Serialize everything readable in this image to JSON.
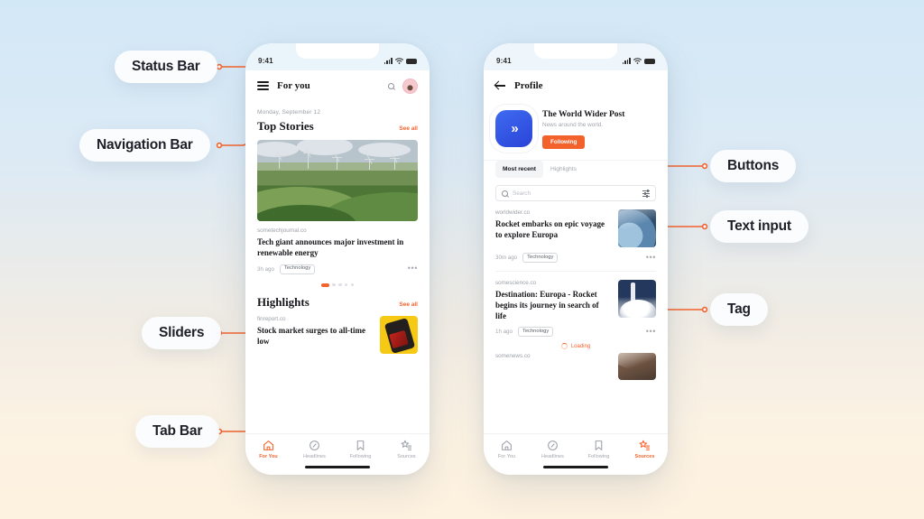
{
  "annotations": [
    {
      "id": "status-bar",
      "label": "Status Bar"
    },
    {
      "id": "navigation-bar",
      "label": "Navigation Bar"
    },
    {
      "id": "sliders",
      "label": "Sliders"
    },
    {
      "id": "tab-bar",
      "label": "Tab Bar"
    },
    {
      "id": "buttons",
      "label": "Buttons"
    },
    {
      "id": "text-input",
      "label": "Text input"
    },
    {
      "id": "tag",
      "label": "Tag"
    }
  ],
  "colors": {
    "accent": "#f4622c",
    "brand_blue": "#2a43d8",
    "text": "#17171b",
    "muted": "#9b9fa6"
  },
  "phone_left": {
    "status": {
      "time": "9:41",
      "icons": [
        "signal-icon",
        "wifi-icon",
        "battery-icon"
      ]
    },
    "nav": {
      "menu_icon": "hamburger-icon",
      "title": "For you",
      "search_icon": "search-icon",
      "avatar": "avatar"
    },
    "date": "Monday, September 12",
    "top_stories": {
      "title": "Top Stories",
      "see_all": "See all",
      "article": {
        "source": "sometechjournal.co",
        "headline": "Tech giant announces major investment in renewable energy",
        "ago": "3h ago",
        "tag": "Technology",
        "more_icon": "more-horizontal-icon"
      },
      "slider": {
        "total": 5,
        "active": 1
      }
    },
    "highlights": {
      "title": "Highlights",
      "see_all": "See all",
      "article": {
        "source": "finreport.co",
        "headline": "Stock market surges to all-time low"
      }
    },
    "tabbar": {
      "active": "For You",
      "items": [
        {
          "label": "For You",
          "icon": "home-icon"
        },
        {
          "label": "Headlines",
          "icon": "compass-icon"
        },
        {
          "label": "Following",
          "icon": "bookmark-icon"
        },
        {
          "label": "Sources",
          "icon": "star-list-icon"
        }
      ]
    }
  },
  "phone_right": {
    "status": {
      "time": "9:41",
      "icons": [
        "signal-icon",
        "wifi-icon",
        "battery-icon"
      ]
    },
    "nav": {
      "back_icon": "back-arrow-icon",
      "title": "Profile"
    },
    "profile": {
      "logo_glyph": "»",
      "name": "The World Wider Post",
      "subtitle": "News around the world.",
      "follow_button": "Following"
    },
    "segments": [
      {
        "label": "Most recent",
        "active": true
      },
      {
        "label": "Highlights",
        "active": false
      }
    ],
    "search": {
      "placeholder": "Search",
      "icon": "search-icon",
      "filter_icon": "filter-sliders-icon"
    },
    "articles": [
      {
        "source": "worldwider.co",
        "headline": "Rocket embarks on epic voyage to explore Europa",
        "ago": "30m ago",
        "tag": "Technology",
        "thumb": "earth-from-space-image",
        "more_icon": "more-horizontal-icon"
      },
      {
        "source": "somescience.co",
        "headline": "Destination: Europa - Rocket begins its journey in search of life",
        "ago": "1h ago",
        "tag": "Technology",
        "thumb": "rocket-launch-image",
        "more_icon": "more-horizontal-icon"
      }
    ],
    "loading": {
      "label": "Loading",
      "icon": "spinner-icon"
    },
    "next_source": "somenews.co",
    "tabbar": {
      "active": "Sources",
      "items": [
        {
          "label": "For You",
          "icon": "home-icon"
        },
        {
          "label": "Headlines",
          "icon": "compass-icon"
        },
        {
          "label": "Following",
          "icon": "bookmark-icon"
        },
        {
          "label": "Sources",
          "icon": "star-list-icon"
        }
      ]
    }
  }
}
